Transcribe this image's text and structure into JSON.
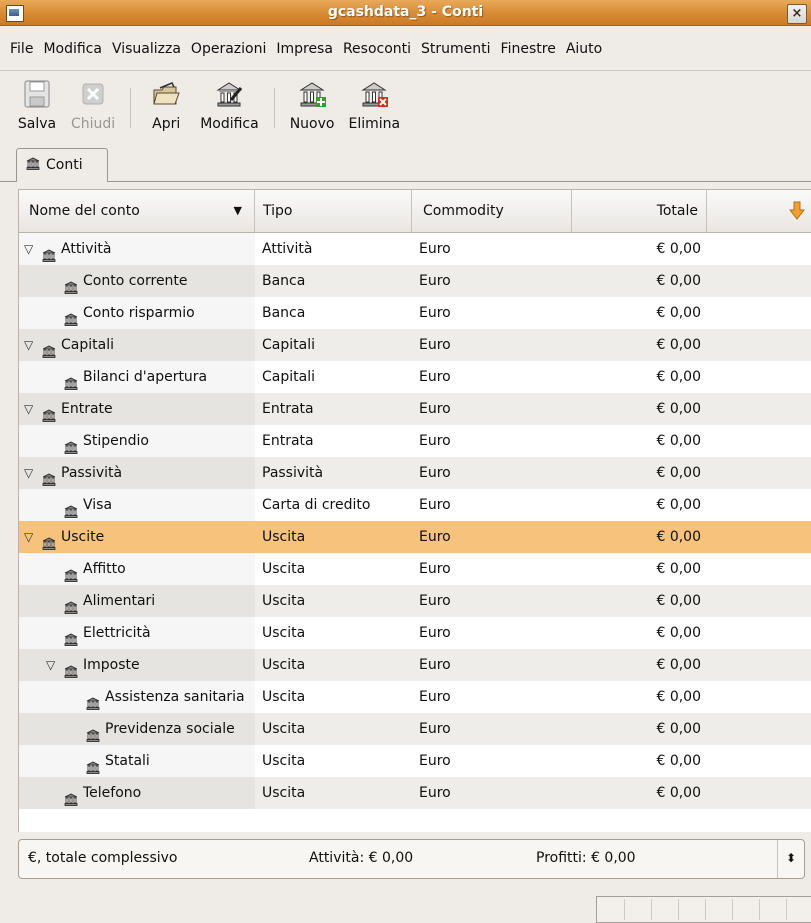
{
  "window": {
    "title": "gcashdata_3 - Conti",
    "close_glyph": "×"
  },
  "menu": [
    "File",
    "Modifica",
    "Visualizza",
    "Operazioni",
    "Impresa",
    "Resoconti",
    "Strumenti",
    "Finestre",
    "Aiuto"
  ],
  "toolbar": {
    "save": "Salva",
    "close": "Chiudi",
    "open": "Apri",
    "edit": "Modifica",
    "new": "Nuovo",
    "delete": "Elimina"
  },
  "tab": {
    "label": "Conti"
  },
  "columns": {
    "name": "Nome del conto",
    "type": "Tipo",
    "commodity": "Commodity",
    "total": "Totale"
  },
  "accounts": [
    {
      "name": "Attività",
      "type": "Attività",
      "commodity": "Euro",
      "total": "€ 0,00",
      "depth": 0,
      "expander": "▽"
    },
    {
      "name": "Conto corrente",
      "type": "Banca",
      "commodity": "Euro",
      "total": "€ 0,00",
      "depth": 1,
      "expander": ""
    },
    {
      "name": "Conto risparmio",
      "type": "Banca",
      "commodity": "Euro",
      "total": "€ 0,00",
      "depth": 1,
      "expander": ""
    },
    {
      "name": "Capitali",
      "type": "Capitali",
      "commodity": "Euro",
      "total": "€ 0,00",
      "depth": 0,
      "expander": "▽"
    },
    {
      "name": "Bilanci d'apertura",
      "type": "Capitali",
      "commodity": "Euro",
      "total": "€ 0,00",
      "depth": 1,
      "expander": ""
    },
    {
      "name": "Entrate",
      "type": "Entrata",
      "commodity": "Euro",
      "total": "€ 0,00",
      "depth": 0,
      "expander": "▽"
    },
    {
      "name": "Stipendio",
      "type": "Entrata",
      "commodity": "Euro",
      "total": "€ 0,00",
      "depth": 1,
      "expander": ""
    },
    {
      "name": "Passività",
      "type": "Passività",
      "commodity": "Euro",
      "total": "€ 0,00",
      "depth": 0,
      "expander": "▽"
    },
    {
      "name": "Visa",
      "type": "Carta di credito",
      "commodity": "Euro",
      "total": "€ 0,00",
      "depth": 1,
      "expander": ""
    },
    {
      "name": "Uscite",
      "type": "Uscita",
      "commodity": "Euro",
      "total": "€ 0,00",
      "depth": 0,
      "expander": "▽",
      "selected": true
    },
    {
      "name": "Affitto",
      "type": "Uscita",
      "commodity": "Euro",
      "total": "€ 0,00",
      "depth": 1,
      "expander": ""
    },
    {
      "name": "Alimentari",
      "type": "Uscita",
      "commodity": "Euro",
      "total": "€ 0,00",
      "depth": 1,
      "expander": ""
    },
    {
      "name": "Elettricità",
      "type": "Uscita",
      "commodity": "Euro",
      "total": "€ 0,00",
      "depth": 1,
      "expander": ""
    },
    {
      "name": "Imposte",
      "type": "Uscita",
      "commodity": "Euro",
      "total": "€ 0,00",
      "depth": 1,
      "expander": "▽"
    },
    {
      "name": "Assistenza sanitaria",
      "type": "Uscita",
      "commodity": "Euro",
      "total": "€ 0,00",
      "depth": 2,
      "expander": ""
    },
    {
      "name": "Previdenza sociale",
      "type": "Uscita",
      "commodity": "Euro",
      "total": "€ 0,00",
      "depth": 2,
      "expander": ""
    },
    {
      "name": "Statali",
      "type": "Uscita",
      "commodity": "Euro",
      "total": "€ 0,00",
      "depth": 2,
      "expander": ""
    },
    {
      "name": "Telefono",
      "type": "Uscita",
      "commodity": "Euro",
      "total": "€ 0,00",
      "depth": 1,
      "expander": ""
    }
  ],
  "summary": {
    "currency": "€, totale complessivo",
    "assets": "Attività: € 0,00",
    "profit": "Profitti: € 0,00",
    "spin_glyph": "⬍"
  },
  "colors": {
    "titlebar": "#d98a33",
    "selection": "#f6c27c",
    "sort_arrow": "#f0a030"
  }
}
